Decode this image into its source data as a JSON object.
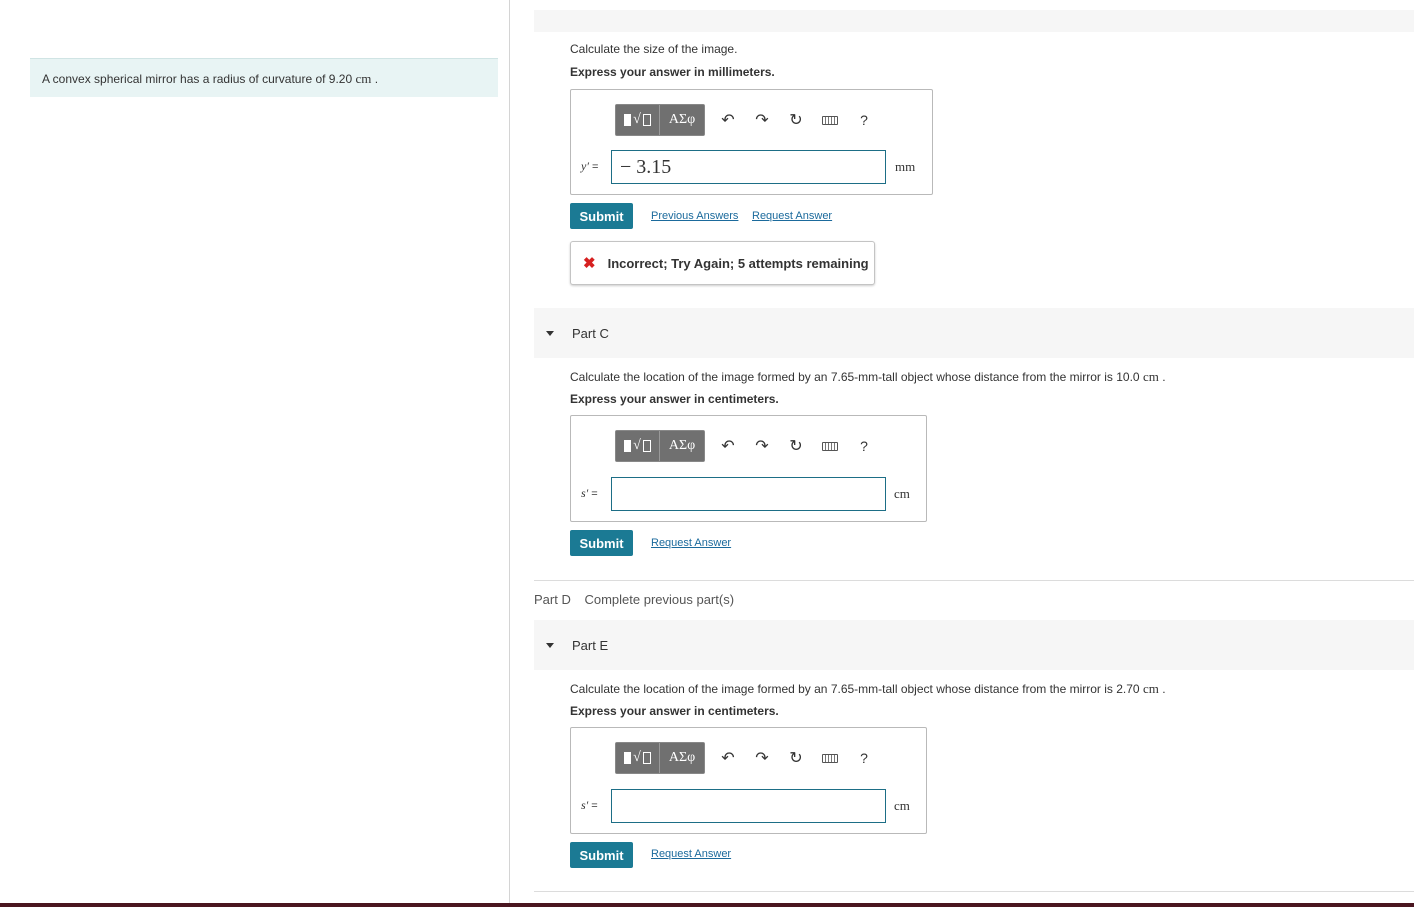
{
  "problem": {
    "text": "A convex spherical mirror has a radius of curvature of 9.20",
    "unit": "cm",
    "end": "."
  },
  "toolbar": {
    "greek_label": "ΑΣφ",
    "help_label": "?"
  },
  "part_b": {
    "question": "Calculate the size of the image.",
    "instruction": "Express your answer in millimeters.",
    "var_symbol": "y′",
    "equals": "=",
    "input_value": "− 3.15",
    "unit": "mm",
    "submit_label": "Submit",
    "previous_answers_label": "Previous Answers",
    "request_answer_label": "Request Answer",
    "feedback_icon": "✖",
    "feedback_text": "Incorrect; Try Again; 5 attempts remaining"
  },
  "part_c": {
    "title": "Part C",
    "question": "Calculate the location of the image formed by an 7.65-mm-tall object whose distance from the mirror is 10.0",
    "question_unit": "cm",
    "question_end": ".",
    "instruction": "Express your answer in centimeters.",
    "var_symbol": "s′",
    "equals": "=",
    "input_value": "",
    "unit": "cm",
    "submit_label": "Submit",
    "request_answer_label": "Request Answer"
  },
  "part_d": {
    "title": "Part D",
    "status": "Complete previous part(s)"
  },
  "part_e": {
    "title": "Part E",
    "question": "Calculate the location of the image formed by an 7.65-mm-tall object whose distance from the mirror is 2.70",
    "question_unit": "cm",
    "question_end": ".",
    "instruction": "Express your answer in centimeters.",
    "var_symbol": "s′",
    "equals": "=",
    "input_value": "",
    "unit": "cm",
    "submit_label": "Submit",
    "request_answer_label": "Request Answer"
  },
  "colors": {
    "accent": "#1b7a94",
    "link": "#1b6a9c",
    "error": "#d62020",
    "problem_bg": "#e8f4f4"
  }
}
